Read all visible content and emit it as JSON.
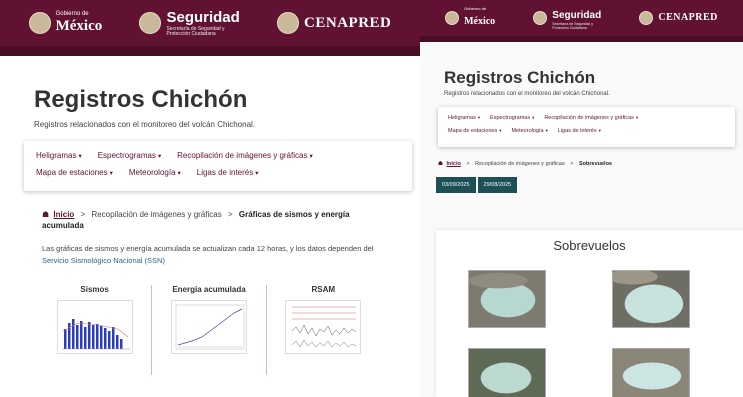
{
  "header": {
    "gobierno_label": "Gobierno de",
    "mexico_label": "México",
    "seguridad_label": "Seguridad",
    "seguridad_sub": "Secretaría de Seguridad y Protección Ciudadana",
    "cenapred_label": "CENAPRED"
  },
  "left_page": {
    "title": "Registros Chichón",
    "subtitle": "Registros relacionados con el monitoreo del volcán Chichonal.",
    "menu_row1": [
      "Heligramas",
      "Espectrogramas",
      "Recopilación de imágenes y gráficas"
    ],
    "menu_row2": [
      "Mapa de estaciones",
      "Meteorología",
      "Ligas de interés"
    ],
    "breadcrumb": {
      "home": "Inicio",
      "section": "Recopilación de imágenes y gráficas",
      "current": "Gráficas de sismos y energía acumulada"
    },
    "intro_text": "Las gráficas de sismos y energía acumulada se actualizan cada 12 horas, y los datos dependen del",
    "intro_link": "Servicio Sismológico Nacional (SSN)",
    "graphs": [
      "Sismos",
      "Energía acumulada",
      "RSAM"
    ]
  },
  "right_page": {
    "title": "Registros Chichón",
    "subtitle": "Registros relacionados con el monitoreo del volcán Chichonal.",
    "menu_row1": [
      "Heligramas",
      "Espectrogramas",
      "Recopilación de imágenes y gráficas"
    ],
    "menu_row2": [
      "Mapa de estaciones",
      "Meteorología",
      "Ligas de interés"
    ],
    "breadcrumb": {
      "home": "Inicio",
      "section": "Recopilación de imágenes y gráficas",
      "current": "Sobrevuelos"
    },
    "date_tabs": [
      "03/09/2025",
      "29/08/2025"
    ],
    "overflights_title": "Sobrevuelos"
  },
  "colors": {
    "brand": "#611232",
    "tab": "#1d4f57",
    "link": "#2a6496"
  },
  "icons": {
    "home": "home-icon",
    "dropdown": "caret-down-icon"
  }
}
